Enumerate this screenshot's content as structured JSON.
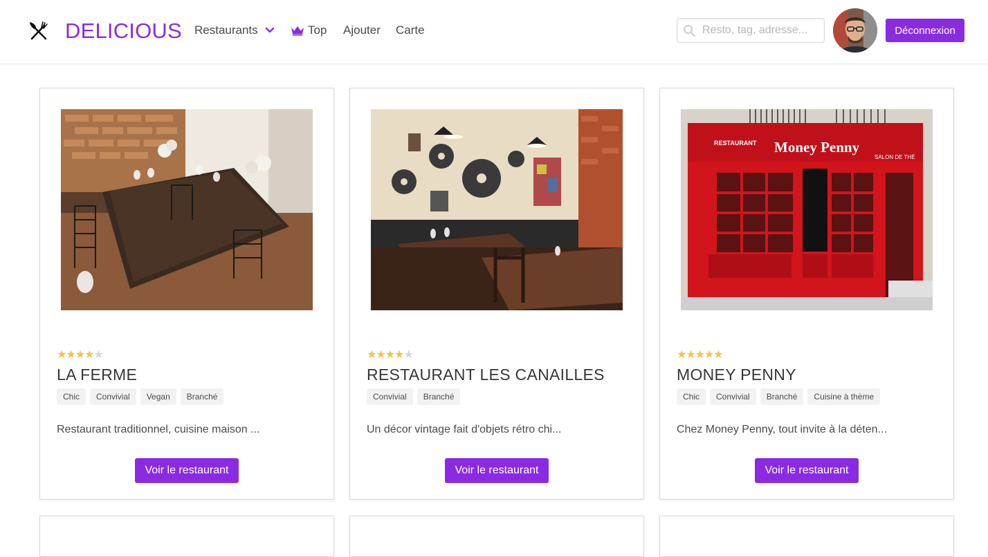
{
  "header": {
    "brand": "DELICIOUS",
    "nav": {
      "restaurants": "Restaurants",
      "top": "Top",
      "ajouter": "Ajouter",
      "carte": "Carte"
    },
    "search_placeholder": "Resto, tag, adresse...",
    "logout_label": "Déconnexion",
    "accent_color": "#8a2be2"
  },
  "cards": [
    {
      "name": "LA FERME",
      "rating": 4,
      "rating_max": 5,
      "tags": [
        "Chic",
        "Convivial",
        "Vegan",
        "Branché"
      ],
      "description": "Restaurant traditionnel, cuisine maison ...",
      "button": "Voir le restaurant"
    },
    {
      "name": "RESTAURANT LES CANAILLES",
      "rating": 4,
      "rating_max": 5,
      "tags": [
        "Convivial",
        "Branché"
      ],
      "description": "Un décor vintage fait d'objets rétro chi...",
      "button": "Voir le restaurant"
    },
    {
      "name": "MONEY PENNY",
      "rating": 5,
      "rating_max": 5,
      "tags": [
        "Chic",
        "Convivial",
        "Branché",
        "Cuisine à thème"
      ],
      "description": "Chez Money Penny, tout invite à la déten...",
      "button": "Voir le restaurant",
      "storefront_sign": "Money Penny",
      "storefront_left": "RESTAURANT",
      "storefront_right": "SALON DE THÉ"
    }
  ]
}
